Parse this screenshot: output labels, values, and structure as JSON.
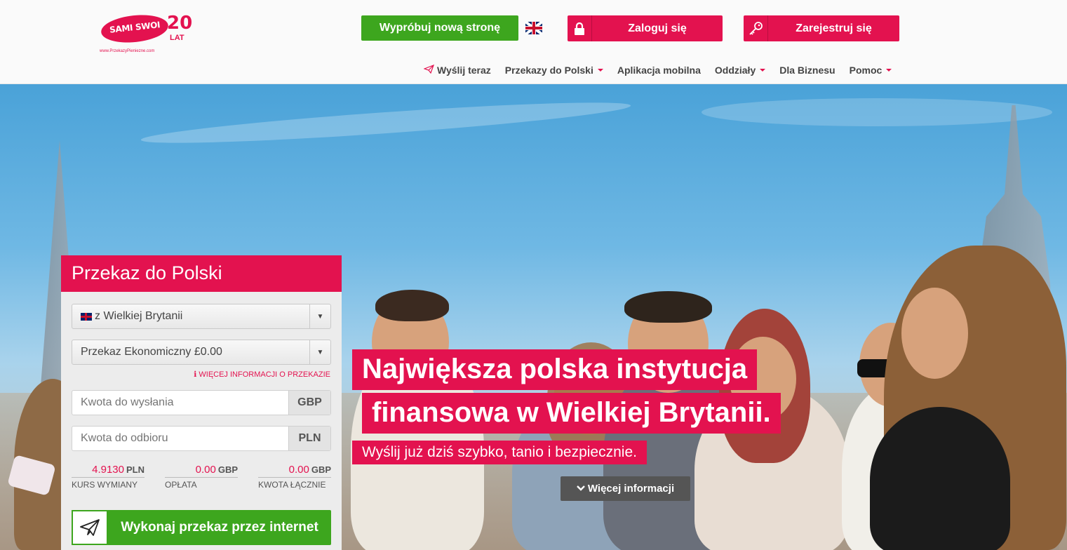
{
  "header": {
    "logo": {
      "brand": "SAMI SWOI",
      "years": "20",
      "years_label": "LAT",
      "site": "www.PrzekazyPieniezne.com"
    },
    "try_new_site": "Wypróbuj nową stronę",
    "login": "Zaloguj się",
    "register": "Zarejestruj się",
    "nav": {
      "send_now": "Wyślij teraz",
      "transfers_to_poland": "Przekazy do Polski",
      "mobile_app": "Aplikacja mobilna",
      "branches": "Oddziały",
      "business": "Dla Biznesu",
      "help": "Pomoc"
    }
  },
  "hero": {
    "headline_line1": "Największa polska instytucja",
    "headline_line2": "finansowa w Wielkiej Brytanii.",
    "subline": "Wyślij już dziś szybko, tanio i bezpiecznie.",
    "more_info": "Więcej informacji"
  },
  "panel": {
    "title": "Przekaz do Polski",
    "country": "z Wielkiej Brytanii",
    "transfer_type": "Przekaz Ekonomiczny £0.00",
    "info_link": "WIĘCEJ INFORMACJI O PRZEKAZIE",
    "send_placeholder": "Kwota do wysłania",
    "send_currency": "GBP",
    "receive_placeholder": "Kwota do odbioru",
    "receive_currency": "PLN",
    "rate_value": "4.9130",
    "rate_unit": "PLN",
    "rate_label": "KURS WYMIANY",
    "fee_value": "0.00",
    "fee_unit": "GBP",
    "fee_label": "OPŁATA",
    "total_value": "0.00",
    "total_unit": "GBP",
    "total_label": "KWOTA ŁĄCZNIE",
    "submit": "Wykonaj przekaz przez internet"
  },
  "colors": {
    "brand_pink": "#e3124f",
    "green": "#3da61e"
  },
  "icons": [
    "lock-icon",
    "key-icon",
    "paper-plane-icon",
    "caret-down-icon",
    "chevron-down-icon",
    "uk-flag-icon",
    "info-icon"
  ]
}
